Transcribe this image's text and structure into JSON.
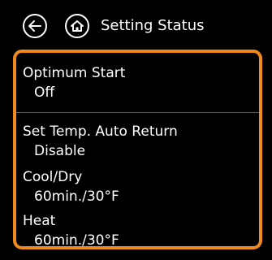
{
  "header": {
    "title": "Setting Status",
    "back_icon": "arrow-left-icon",
    "home_icon": "home-icon"
  },
  "colors": {
    "accent": "#f08a1e",
    "background": "#000000",
    "text": "#ffffff",
    "divider": "#5a5a5a"
  },
  "settings": [
    {
      "label": "Optimum Start",
      "value": "Off"
    },
    {
      "label": "Set Temp. Auto Return",
      "value": "Disable"
    },
    {
      "label": "Cool/Dry",
      "value": "60min./30°F"
    },
    {
      "label": "Heat",
      "value": "60min./30°F"
    }
  ]
}
